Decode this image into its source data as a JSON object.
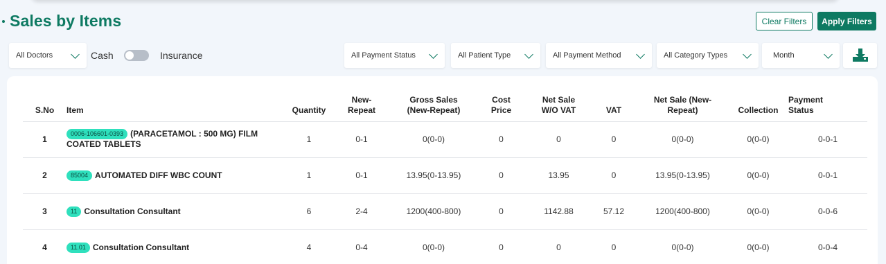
{
  "page": {
    "title": "Sales by Items"
  },
  "actions": {
    "clear_filters": "Clear Filters",
    "apply_filters": "Apply Filters"
  },
  "filters": {
    "doctors": "All Doctors",
    "cash_label": "Cash",
    "insurance_label": "Insurance",
    "payment_status": "All Payment Status",
    "patient_type": "All Patient Type",
    "payment_method": "All Payment Method",
    "category_types": "All Category Types",
    "period": "Month"
  },
  "colors": {
    "accent": "#0e7a62",
    "badge": "#2fe0bd",
    "toggle_off": "#b7bec8"
  },
  "icons": {
    "download": "download-icon",
    "chevron": "chevron-down-icon"
  },
  "table": {
    "headers": {
      "sno": "S.No",
      "item": "Item",
      "quantity": "Quantity",
      "new_repeat_1": "New-",
      "new_repeat_2": "Repeat",
      "gross_1": "Gross Sales",
      "gross_2": "(New-Repeat)",
      "cost_1": "Cost",
      "cost_2": "Price",
      "net_wo_vat_1": "Net Sale",
      "net_wo_vat_2": "W/O VAT",
      "vat": "VAT",
      "net_nr_1": "Net Sale (New-",
      "net_nr_2": "Repeat)",
      "collection": "Collection",
      "pay_status_1": "Payment",
      "pay_status_2": "Status"
    },
    "rows": [
      {
        "sno": "1",
        "code": "0006-106601-0393",
        "name": "(PARACETAMOL : 500 MG) FILM",
        "name2": "COATED TABLETS",
        "quantity": "1",
        "new_repeat": "0-1",
        "gross": "0(0-0)",
        "cost": "0",
        "net_wo_vat": "0",
        "vat": "0",
        "net_nr": "0(0-0)",
        "collection": "0(0-0)",
        "status": "0-0-1"
      },
      {
        "sno": "2",
        "code": "85004",
        "name": "AUTOMATED DIFF WBC COUNT",
        "quantity": "1",
        "new_repeat": "0-1",
        "gross": "13.95(0-13.95)",
        "cost": "0",
        "net_wo_vat": "13.95",
        "vat": "0",
        "net_nr": "13.95(0-13.95)",
        "collection": "0(0-0)",
        "status": "0-0-1"
      },
      {
        "sno": "3",
        "code": "11",
        "name": "Consultation Consultant",
        "quantity": "6",
        "new_repeat": "2-4",
        "gross": "1200(400-800)",
        "cost": "0",
        "net_wo_vat": "1142.88",
        "vat": "57.12",
        "net_nr": "1200(400-800)",
        "collection": "0(0-0)",
        "status": "0-0-6"
      },
      {
        "sno": "4",
        "code": "11.01",
        "name": "Consultation Consultant",
        "quantity": "4",
        "new_repeat": "0-4",
        "gross": "0(0-0)",
        "cost": "0",
        "net_wo_vat": "0",
        "vat": "0",
        "net_nr": "0(0-0)",
        "collection": "0(0-0)",
        "status": "0-0-4"
      }
    ]
  }
}
